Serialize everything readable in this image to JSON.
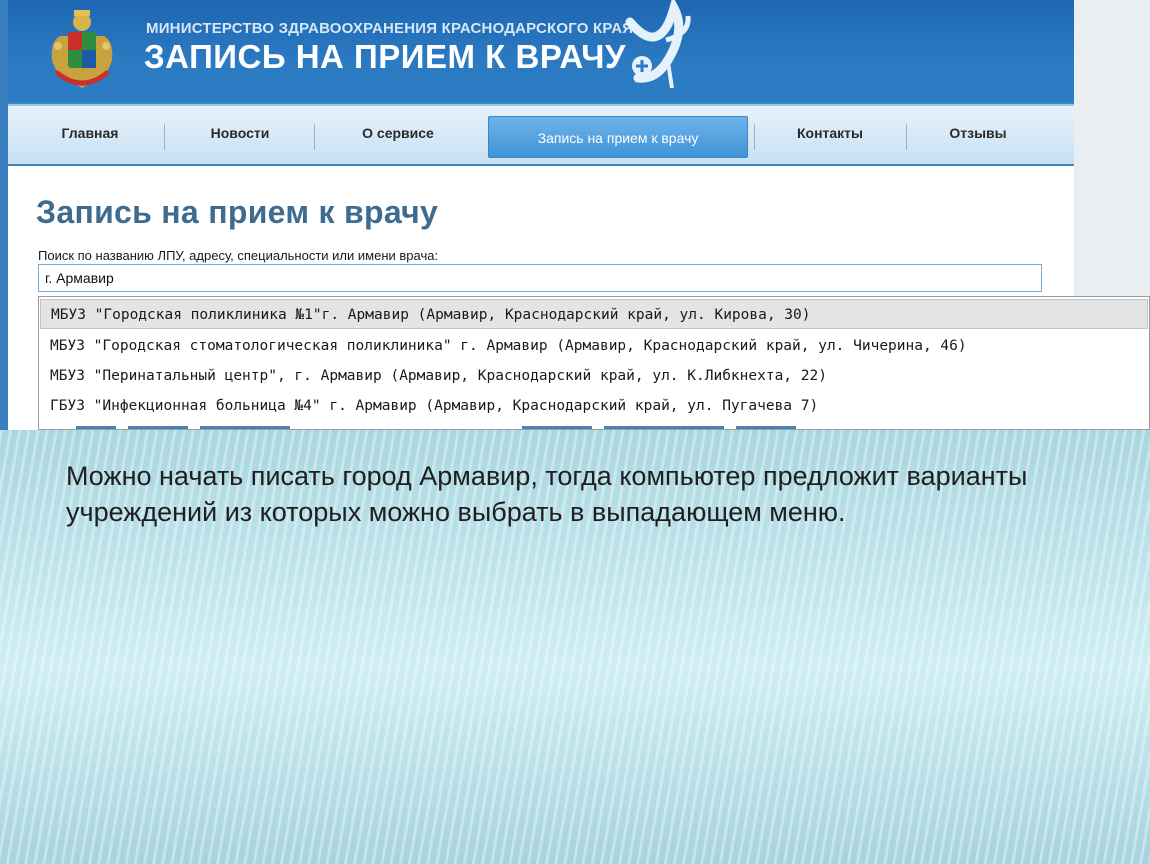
{
  "header": {
    "ministry": "МИНИСТЕРСТВО ЗДРАВООХРАНЕНИЯ КРАСНОДАРСКОГО КРАЯ",
    "title": "ЗАПИСЬ НА ПРИЕМ К ВРАЧУ"
  },
  "nav": {
    "items": [
      {
        "label": "Главная"
      },
      {
        "label": "Новости"
      },
      {
        "label": "О сервисе"
      },
      {
        "label": "Запись на прием к врачу",
        "active": true
      },
      {
        "label": "Контакты"
      },
      {
        "label": "Отзывы"
      }
    ]
  },
  "main": {
    "heading": "Запись на прием к врачу",
    "search_label": "Поиск по названию ЛПУ, адресу, специальности или имени врача:",
    "search_value": "г. Армавир"
  },
  "dropdown": {
    "items": [
      "МБУЗ \"Городская поликлиника №1\"г. Армавир (Армавир, Краснодарский край, ул. Кирова, 30)",
      "МБУЗ \"Городская стоматологическая поликлиника\" г. Армавир (Армавир, Краснодарский край, ул. Чичерина, 46)",
      "МБУЗ \"Перинатальный центр\", г. Армавир (Армавир, Краснодарский край, ул. К.Либкнехта, 22)",
      "ГБУЗ \"Инфекционная больница №4\" г. Армавир (Армавир, Краснодарский край, ул. Пугачева 7)"
    ],
    "highlighted_index": 0
  },
  "slide": {
    "caption": "Можно начать писать город Армавир, тогда компьютер предложит варианты учреждений из которых можно выбрать в выпадающем меню."
  },
  "colors": {
    "header_blue": "#2b7ac2",
    "active_tab": "#3f93d8",
    "heading": "#3f6b8f",
    "slide_bg": "#bfe3ea"
  },
  "icons": [
    "coat-of-arms-icon",
    "medical-emblem-icon"
  ]
}
